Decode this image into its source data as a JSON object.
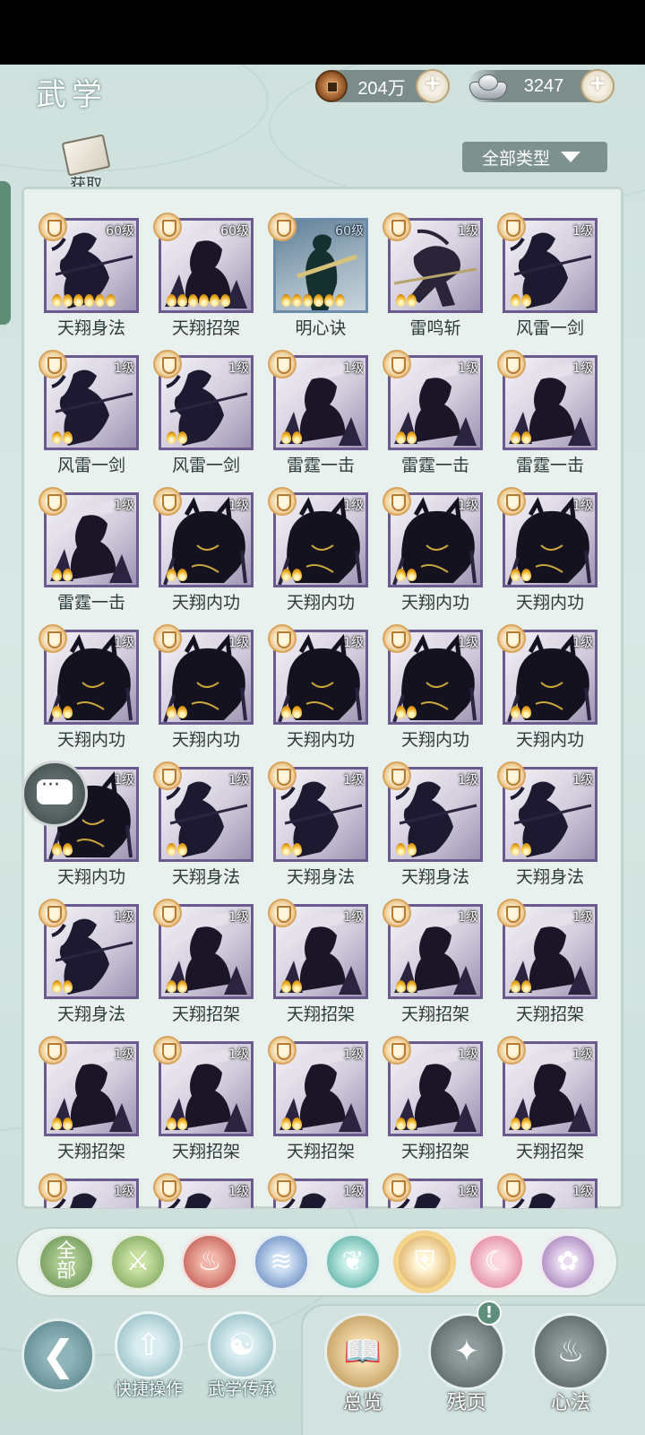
{
  "header": {
    "title": "武学",
    "coins": "204万",
    "silver": "3247",
    "obtain_label": "获取",
    "filter_label": "全部类型"
  },
  "colors": {
    "panel_bg": "#e9f1ef",
    "frame_purple": "#6b5a8e",
    "frame_blue": "#6a8baa",
    "gold_badge": "#d9a45c"
  },
  "skills": [
    {
      "name": "天翔身法",
      "level": "60级",
      "stars": 6,
      "frame": "purple",
      "art": "figure"
    },
    {
      "name": "天翔招架",
      "level": "60级",
      "stars": 6,
      "frame": "purple",
      "art": "slash"
    },
    {
      "name": "明心诀",
      "level": "60级",
      "stars": 6,
      "frame": "blue",
      "art": "standing"
    },
    {
      "name": "雷鸣斩",
      "level": "1级",
      "stars": 2,
      "frame": "purple",
      "art": "leap"
    },
    {
      "name": "风雷一剑",
      "level": "1级",
      "stars": 2,
      "frame": "purple",
      "art": "figure"
    },
    {
      "name": "风雷一剑",
      "level": "1级",
      "stars": 2,
      "frame": "purple",
      "art": "figure"
    },
    {
      "name": "风雷一剑",
      "level": "1级",
      "stars": 2,
      "frame": "purple",
      "art": "figure"
    },
    {
      "name": "雷霆一击",
      "level": "1级",
      "stars": 2,
      "frame": "purple",
      "art": "slash"
    },
    {
      "name": "雷霆一击",
      "level": "1级",
      "stars": 2,
      "frame": "purple",
      "art": "slash"
    },
    {
      "name": "雷霆一击",
      "level": "1级",
      "stars": 2,
      "frame": "purple",
      "art": "slash"
    },
    {
      "name": "雷霆一击",
      "level": "1级",
      "stars": 2,
      "frame": "purple",
      "art": "slash"
    },
    {
      "name": "天翔内功",
      "level": "1级",
      "stars": 2,
      "frame": "purple",
      "art": "beast"
    },
    {
      "name": "天翔内功",
      "level": "1级",
      "stars": 2,
      "frame": "purple",
      "art": "beast"
    },
    {
      "name": "天翔内功",
      "level": "1级",
      "stars": 2,
      "frame": "purple",
      "art": "beast"
    },
    {
      "name": "天翔内功",
      "level": "1级",
      "stars": 2,
      "frame": "purple",
      "art": "beast"
    },
    {
      "name": "天翔内功",
      "level": "1级",
      "stars": 2,
      "frame": "purple",
      "art": "beast"
    },
    {
      "name": "天翔内功",
      "level": "1级",
      "stars": 2,
      "frame": "purple",
      "art": "beast"
    },
    {
      "name": "天翔内功",
      "level": "1级",
      "stars": 2,
      "frame": "purple",
      "art": "beast"
    },
    {
      "name": "天翔内功",
      "level": "1级",
      "stars": 2,
      "frame": "purple",
      "art": "beast"
    },
    {
      "name": "天翔内功",
      "level": "1级",
      "stars": 2,
      "frame": "purple",
      "art": "beast"
    },
    {
      "name": "天翔内功",
      "level": "1级",
      "stars": 2,
      "frame": "purple",
      "art": "beast"
    },
    {
      "name": "天翔身法",
      "level": "1级",
      "stars": 2,
      "frame": "purple",
      "art": "figure"
    },
    {
      "name": "天翔身法",
      "level": "1级",
      "stars": 2,
      "frame": "purple",
      "art": "figure"
    },
    {
      "name": "天翔身法",
      "level": "1级",
      "stars": 2,
      "frame": "purple",
      "art": "figure"
    },
    {
      "name": "天翔身法",
      "level": "1级",
      "stars": 2,
      "frame": "purple",
      "art": "figure"
    },
    {
      "name": "天翔身法",
      "level": "1级",
      "stars": 2,
      "frame": "purple",
      "art": "figure"
    },
    {
      "name": "天翔招架",
      "level": "1级",
      "stars": 2,
      "frame": "purple",
      "art": "slash"
    },
    {
      "name": "天翔招架",
      "level": "1级",
      "stars": 2,
      "frame": "purple",
      "art": "slash"
    },
    {
      "name": "天翔招架",
      "level": "1级",
      "stars": 2,
      "frame": "purple",
      "art": "slash"
    },
    {
      "name": "天翔招架",
      "level": "1级",
      "stars": 2,
      "frame": "purple",
      "art": "slash"
    },
    {
      "name": "天翔招架",
      "level": "1级",
      "stars": 2,
      "frame": "purple",
      "art": "slash"
    },
    {
      "name": "天翔招架",
      "level": "1级",
      "stars": 2,
      "frame": "purple",
      "art": "slash"
    },
    {
      "name": "天翔招架",
      "level": "1级",
      "stars": 2,
      "frame": "purple",
      "art": "slash"
    },
    {
      "name": "天翔招架",
      "level": "1级",
      "stars": 2,
      "frame": "purple",
      "art": "slash"
    },
    {
      "name": "天翔招架",
      "level": "1级",
      "stars": 2,
      "frame": "purple",
      "art": "slash"
    },
    {
      "name": "",
      "level": "1级",
      "stars": 0,
      "frame": "purple",
      "art": "figure"
    },
    {
      "name": "",
      "level": "1级",
      "stars": 0,
      "frame": "purple",
      "art": "figure"
    },
    {
      "name": "",
      "level": "1级",
      "stars": 0,
      "frame": "purple",
      "art": "figure"
    },
    {
      "name": "",
      "level": "1级",
      "stars": 0,
      "frame": "purple",
      "art": "figure"
    },
    {
      "name": "",
      "level": "1级",
      "stars": 0,
      "frame": "purple",
      "art": "figure"
    }
  ],
  "categories": [
    {
      "label": "全部",
      "style": "all",
      "icon": "all-text"
    },
    {
      "label": "",
      "style": "green",
      "icon": "sword-icon"
    },
    {
      "label": "",
      "style": "red",
      "icon": "flame-icon"
    },
    {
      "label": "",
      "style": "blue",
      "icon": "wave-icon"
    },
    {
      "label": "",
      "style": "teal",
      "icon": "butterfly-icon"
    },
    {
      "label": "",
      "style": "gold",
      "icon": "shield-icon"
    },
    {
      "label": "",
      "style": "pink",
      "icon": "moon-icon"
    },
    {
      "label": "",
      "style": "purple",
      "icon": "rose-icon"
    }
  ],
  "bottom": {
    "quick_ops": "快捷操作",
    "inherit": "武学传承",
    "overview": "总览",
    "fragments": "残页",
    "mind": "心法",
    "alert": "!"
  }
}
